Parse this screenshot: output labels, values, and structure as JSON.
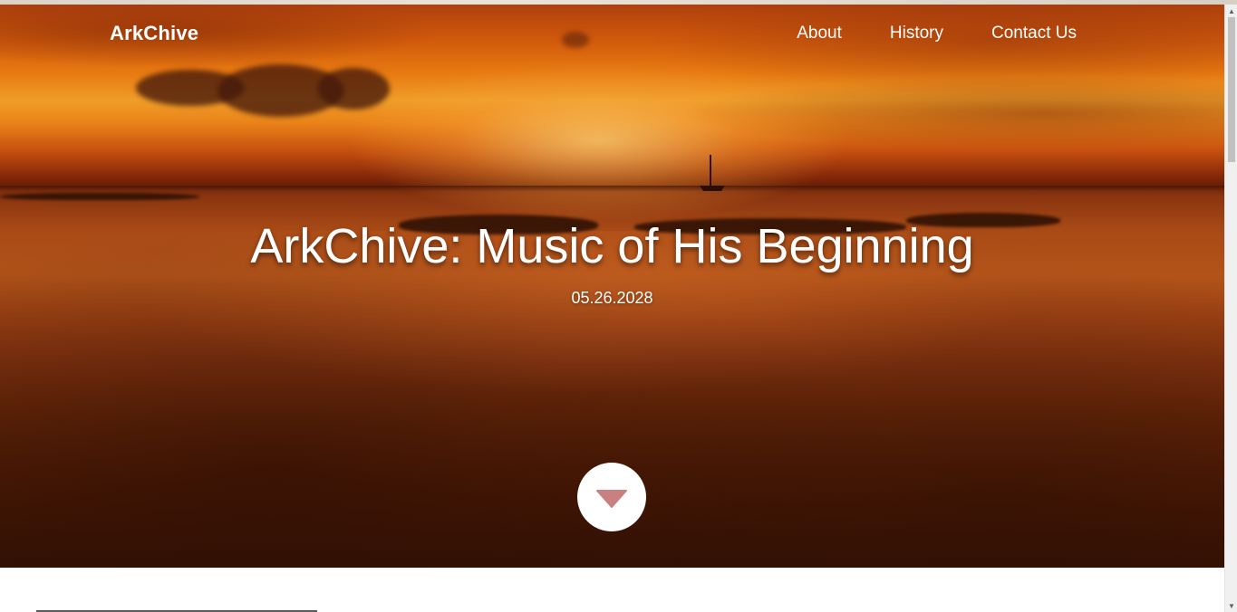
{
  "header": {
    "brand": "ArkChive",
    "nav": [
      {
        "label": "About"
      },
      {
        "label": "History"
      },
      {
        "label": "Contact Us"
      }
    ]
  },
  "hero": {
    "title": "ArkChive: Music of His Beginning",
    "date": "05.26.2028",
    "scroll_icon": "chevron-down-icon",
    "scroll_icon_color": "#c98080"
  },
  "colors": {
    "sky_top": "#b8430e",
    "sun": "#f6a22a",
    "sand_dark": "#421505",
    "text": "#ffffff"
  }
}
